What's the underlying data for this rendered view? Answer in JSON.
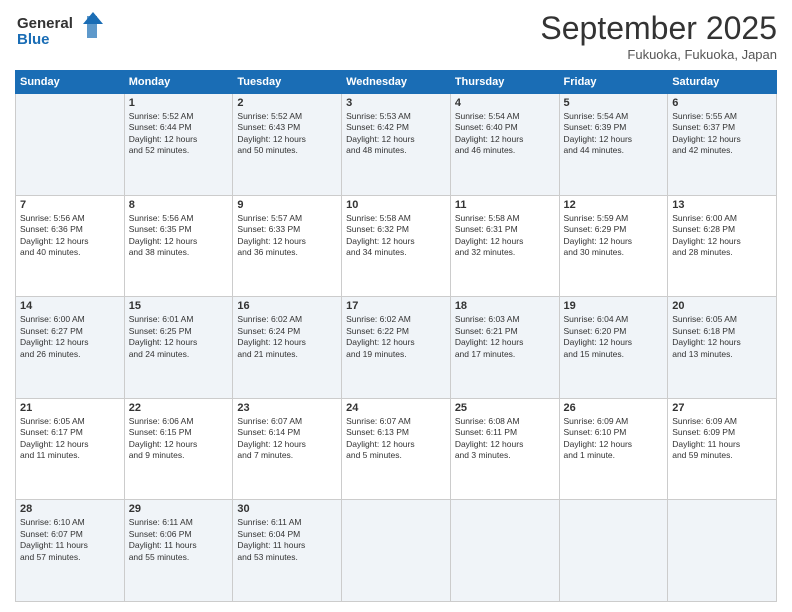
{
  "logo": {
    "line1": "General",
    "line2": "Blue"
  },
  "title": "September 2025",
  "subtitle": "Fukuoka, Fukuoka, Japan",
  "days_of_week": [
    "Sunday",
    "Monday",
    "Tuesday",
    "Wednesday",
    "Thursday",
    "Friday",
    "Saturday"
  ],
  "weeks": [
    [
      {
        "day": "",
        "info": ""
      },
      {
        "day": "1",
        "info": "Sunrise: 5:52 AM\nSunset: 6:44 PM\nDaylight: 12 hours\nand 52 minutes."
      },
      {
        "day": "2",
        "info": "Sunrise: 5:52 AM\nSunset: 6:43 PM\nDaylight: 12 hours\nand 50 minutes."
      },
      {
        "day": "3",
        "info": "Sunrise: 5:53 AM\nSunset: 6:42 PM\nDaylight: 12 hours\nand 48 minutes."
      },
      {
        "day": "4",
        "info": "Sunrise: 5:54 AM\nSunset: 6:40 PM\nDaylight: 12 hours\nand 46 minutes."
      },
      {
        "day": "5",
        "info": "Sunrise: 5:54 AM\nSunset: 6:39 PM\nDaylight: 12 hours\nand 44 minutes."
      },
      {
        "day": "6",
        "info": "Sunrise: 5:55 AM\nSunset: 6:37 PM\nDaylight: 12 hours\nand 42 minutes."
      }
    ],
    [
      {
        "day": "7",
        "info": "Sunrise: 5:56 AM\nSunset: 6:36 PM\nDaylight: 12 hours\nand 40 minutes."
      },
      {
        "day": "8",
        "info": "Sunrise: 5:56 AM\nSunset: 6:35 PM\nDaylight: 12 hours\nand 38 minutes."
      },
      {
        "day": "9",
        "info": "Sunrise: 5:57 AM\nSunset: 6:33 PM\nDaylight: 12 hours\nand 36 minutes."
      },
      {
        "day": "10",
        "info": "Sunrise: 5:58 AM\nSunset: 6:32 PM\nDaylight: 12 hours\nand 34 minutes."
      },
      {
        "day": "11",
        "info": "Sunrise: 5:58 AM\nSunset: 6:31 PM\nDaylight: 12 hours\nand 32 minutes."
      },
      {
        "day": "12",
        "info": "Sunrise: 5:59 AM\nSunset: 6:29 PM\nDaylight: 12 hours\nand 30 minutes."
      },
      {
        "day": "13",
        "info": "Sunrise: 6:00 AM\nSunset: 6:28 PM\nDaylight: 12 hours\nand 28 minutes."
      }
    ],
    [
      {
        "day": "14",
        "info": "Sunrise: 6:00 AM\nSunset: 6:27 PM\nDaylight: 12 hours\nand 26 minutes."
      },
      {
        "day": "15",
        "info": "Sunrise: 6:01 AM\nSunset: 6:25 PM\nDaylight: 12 hours\nand 24 minutes."
      },
      {
        "day": "16",
        "info": "Sunrise: 6:02 AM\nSunset: 6:24 PM\nDaylight: 12 hours\nand 21 minutes."
      },
      {
        "day": "17",
        "info": "Sunrise: 6:02 AM\nSunset: 6:22 PM\nDaylight: 12 hours\nand 19 minutes."
      },
      {
        "day": "18",
        "info": "Sunrise: 6:03 AM\nSunset: 6:21 PM\nDaylight: 12 hours\nand 17 minutes."
      },
      {
        "day": "19",
        "info": "Sunrise: 6:04 AM\nSunset: 6:20 PM\nDaylight: 12 hours\nand 15 minutes."
      },
      {
        "day": "20",
        "info": "Sunrise: 6:05 AM\nSunset: 6:18 PM\nDaylight: 12 hours\nand 13 minutes."
      }
    ],
    [
      {
        "day": "21",
        "info": "Sunrise: 6:05 AM\nSunset: 6:17 PM\nDaylight: 12 hours\nand 11 minutes."
      },
      {
        "day": "22",
        "info": "Sunrise: 6:06 AM\nSunset: 6:15 PM\nDaylight: 12 hours\nand 9 minutes."
      },
      {
        "day": "23",
        "info": "Sunrise: 6:07 AM\nSunset: 6:14 PM\nDaylight: 12 hours\nand 7 minutes."
      },
      {
        "day": "24",
        "info": "Sunrise: 6:07 AM\nSunset: 6:13 PM\nDaylight: 12 hours\nand 5 minutes."
      },
      {
        "day": "25",
        "info": "Sunrise: 6:08 AM\nSunset: 6:11 PM\nDaylight: 12 hours\nand 3 minutes."
      },
      {
        "day": "26",
        "info": "Sunrise: 6:09 AM\nSunset: 6:10 PM\nDaylight: 12 hours\nand 1 minute."
      },
      {
        "day": "27",
        "info": "Sunrise: 6:09 AM\nSunset: 6:09 PM\nDaylight: 11 hours\nand 59 minutes."
      }
    ],
    [
      {
        "day": "28",
        "info": "Sunrise: 6:10 AM\nSunset: 6:07 PM\nDaylight: 11 hours\nand 57 minutes."
      },
      {
        "day": "29",
        "info": "Sunrise: 6:11 AM\nSunset: 6:06 PM\nDaylight: 11 hours\nand 55 minutes."
      },
      {
        "day": "30",
        "info": "Sunrise: 6:11 AM\nSunset: 6:04 PM\nDaylight: 11 hours\nand 53 minutes."
      },
      {
        "day": "",
        "info": ""
      },
      {
        "day": "",
        "info": ""
      },
      {
        "day": "",
        "info": ""
      },
      {
        "day": "",
        "info": ""
      }
    ]
  ]
}
